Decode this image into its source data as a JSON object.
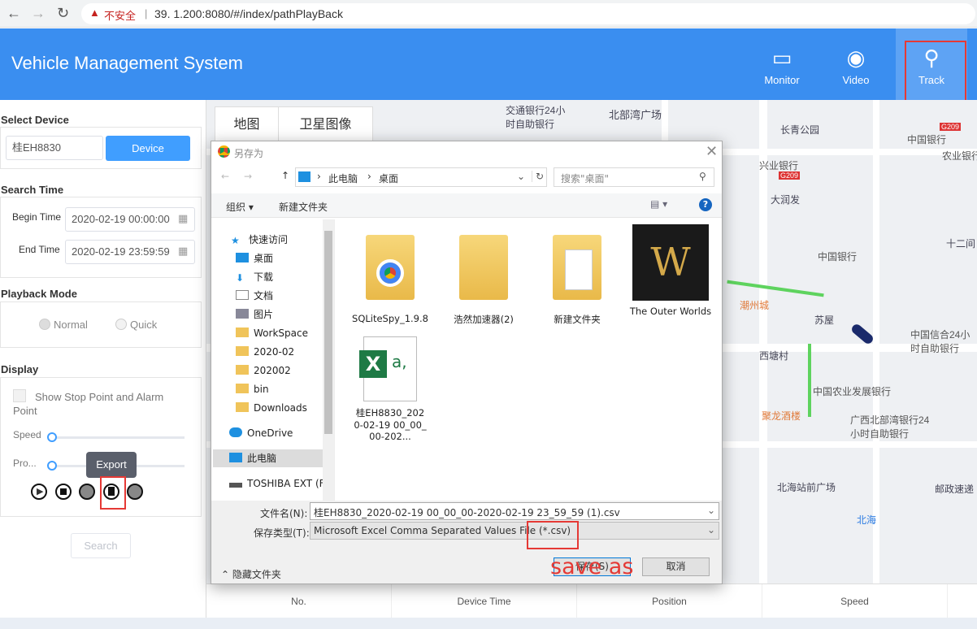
{
  "browser": {
    "insecure_label": "不安全",
    "url": "39.   1.200:8080/#/index/pathPlayBack"
  },
  "header": {
    "title": "Vehicle Management System",
    "nav": [
      {
        "label": "Monitor",
        "icon": "monitor-icon"
      },
      {
        "label": "Video",
        "icon": "camera-icon"
      },
      {
        "label": "Track",
        "icon": "track-pin-icon",
        "active": true
      }
    ]
  },
  "sidebar": {
    "select_device": {
      "title": "Select Device",
      "value": "桂EH8830",
      "button": "Device"
    },
    "search_time": {
      "title": "Search Time",
      "begin_label": "Begin Time",
      "begin_value": "2020-02-19 00:00:00",
      "end_label": "End Time",
      "end_value": "2020-02-19 23:59:59"
    },
    "playback_mode": {
      "title": "Playback Mode",
      "options": [
        "Normal",
        "Quick"
      ],
      "selected": "Normal"
    },
    "display": {
      "title": "Display",
      "checkbox_label": "Show Stop Point and Alarm Point",
      "checked": false,
      "speed_label": "Speed",
      "speed_value": 0,
      "progress_label": "Pro...",
      "progress_value": 0,
      "tooltip": "Export"
    },
    "search_button": "Search"
  },
  "map": {
    "tabs": [
      "地图",
      "卫星图像"
    ],
    "labels": [
      "交通银行24小时自助银行",
      "北部湾广场",
      "长青公园",
      "中国银行",
      "农业银行",
      "兴业银行",
      "大润发",
      "十二间",
      "中国银行",
      "潮州城",
      "苏屋",
      "西塘村",
      "中国信合24小时自助银行",
      "中国农业发展银行",
      "聚龙酒楼",
      "广西北部湾银行24小时自助银行",
      "北海站前广场",
      "邮政速递",
      "北海",
      "G209",
      "G209"
    ]
  },
  "table": {
    "columns": [
      "No.",
      "Device Time",
      "Position",
      "Speed"
    ]
  },
  "dialog": {
    "title": "另存为",
    "breadcrumb": [
      "此电脑",
      "桌面"
    ],
    "search_placeholder": "搜索\"桌面\"",
    "toolbar": {
      "organize": "组织 ▾",
      "new_folder": "新建文件夹"
    },
    "nav": [
      "快速访问",
      "桌面",
      "下载",
      "文档",
      "图片",
      "WorkSpace",
      "2020-02",
      "202002",
      "bin",
      "Downloads",
      "OneDrive",
      "此电脑",
      "TOSHIBA EXT (F"
    ],
    "files": [
      {
        "name": "SQLiteSpy_1.9.8",
        "type": "folder-chrome"
      },
      {
        "name": "浩然加速器(2)",
        "type": "folder"
      },
      {
        "name": "新建文件夹",
        "type": "folder-doc"
      },
      {
        "name": "The Outer Worlds",
        "type": "shortcut"
      },
      {
        "name": "桂EH8830_2020-02-19 00_00_00-202...",
        "type": "excel"
      }
    ],
    "filename_label": "文件名(N):",
    "filename_value": "桂EH8830_2020-02-19 00_00_00-2020-02-19 23_59_59 (1).csv",
    "filetype_label": "保存类型(T):",
    "filetype_value": "Microsoft Excel Comma Separated Values File (*.csv)",
    "hide_folders": "隐藏文件夹",
    "save": "保存(S)",
    "cancel": "取消"
  },
  "annotation": {
    "text": "save as",
    "color": "#e53935"
  },
  "colors": {
    "header": "#3a8ef0",
    "accent": "#409eff"
  }
}
